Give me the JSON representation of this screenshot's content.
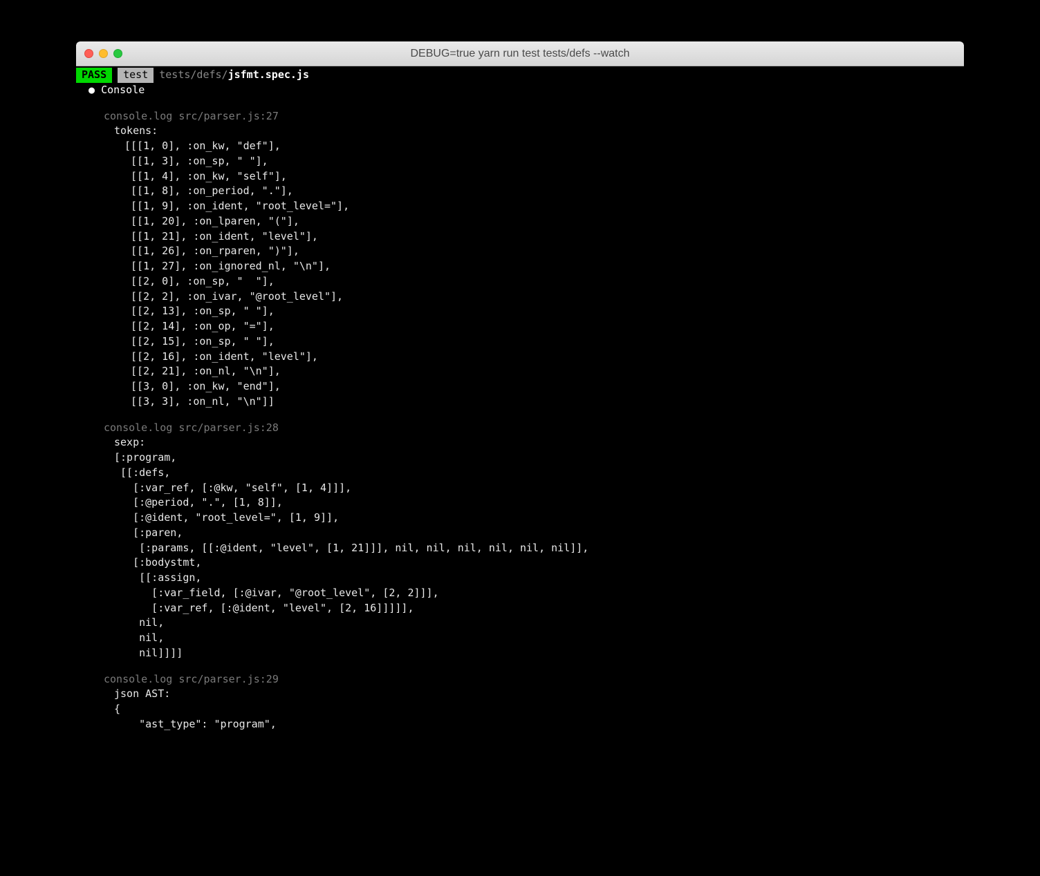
{
  "window": {
    "title": "DEBUG=true yarn run test tests/defs --watch"
  },
  "status": {
    "pass_label": "PASS",
    "test_label": "test",
    "path_dir": "tests/defs/",
    "path_file": "jsfmt.spec.js"
  },
  "console": {
    "header": "Console",
    "bullet": "●"
  },
  "logs": [
    {
      "location": "console.log src/parser.js:27",
      "label": "tokens:",
      "lines": [
        "[[[1, 0], :on_kw, \"def\"],",
        " [[1, 3], :on_sp, \" \"],",
        " [[1, 4], :on_kw, \"self\"],",
        " [[1, 8], :on_period, \".\"],",
        " [[1, 9], :on_ident, \"root_level=\"],",
        " [[1, 20], :on_lparen, \"(\"],",
        " [[1, 21], :on_ident, \"level\"],",
        " [[1, 26], :on_rparen, \")\"],",
        " [[1, 27], :on_ignored_nl, \"\\n\"],",
        " [[2, 0], :on_sp, \"  \"],",
        " [[2, 2], :on_ivar, \"@root_level\"],",
        " [[2, 13], :on_sp, \" \"],",
        " [[2, 14], :on_op, \"=\"],",
        " [[2, 15], :on_sp, \" \"],",
        " [[2, 16], :on_ident, \"level\"],",
        " [[2, 21], :on_nl, \"\\n\"],",
        " [[3, 0], :on_kw, \"end\"],",
        " [[3, 3], :on_nl, \"\\n\"]]"
      ]
    },
    {
      "location": "console.log src/parser.js:28",
      "label": "sexp:",
      "lines": [
        "[:program,",
        " [[:defs,",
        "   [:var_ref, [:@kw, \"self\", [1, 4]]],",
        "   [:@period, \".\", [1, 8]],",
        "   [:@ident, \"root_level=\", [1, 9]],",
        "   [:paren,",
        "    [:params, [[:@ident, \"level\", [1, 21]]], nil, nil, nil, nil, nil, nil]],",
        "   [:bodystmt,",
        "    [[:assign,",
        "      [:var_field, [:@ivar, \"@root_level\", [2, 2]]],",
        "      [:var_ref, [:@ident, \"level\", [2, 16]]]]],",
        "    nil,",
        "    nil,",
        "    nil]]]]"
      ]
    },
    {
      "location": "console.log src/parser.js:29",
      "label": "json AST:",
      "lines": [
        "{",
        "    \"ast_type\": \"program\","
      ]
    }
  ]
}
